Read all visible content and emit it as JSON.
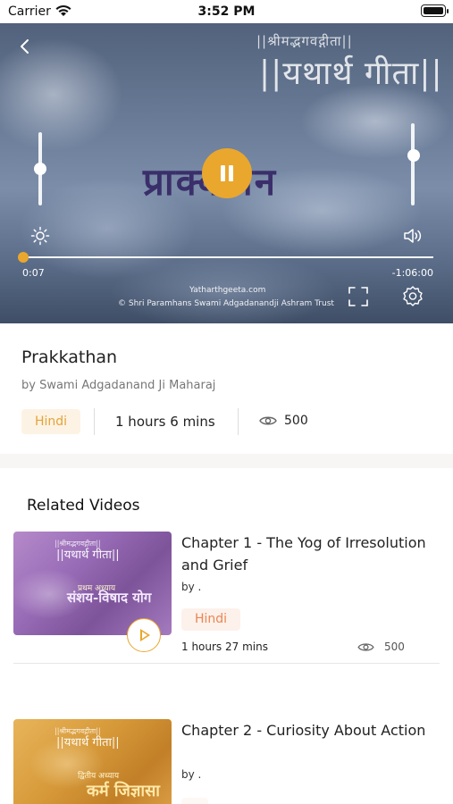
{
  "status_bar": {
    "carrier": "Carrier",
    "time": "3:52 PM",
    "icons": [
      "wifi-icon",
      "battery-icon"
    ]
  },
  "player": {
    "back_icon": "chevron-left-icon",
    "sub_title": "||श्रीमद्भगवद्गीता||",
    "title": "||यथार्थ गीता||",
    "center_text": "प्राक्कथन",
    "state": "playing",
    "pause_icon": "pause-icon",
    "brightness_level": 0.6,
    "volume_level": 0.62,
    "progress": 0.0,
    "current_time": "0:07",
    "remaining_time": "-1:06:00",
    "watermark_site": "Yatharthgeeta.com",
    "watermark_trust": "© Shri Paramhans Swami Adgadanandji Ashram Trust",
    "icons": [
      "brightness-icon",
      "volume-icon",
      "fullscreen-icon",
      "settings-icon"
    ],
    "accent_color": "#e9a72e"
  },
  "video": {
    "title": "Prakkathan",
    "author": "by Swami Adgadanand Ji Maharaj",
    "language": "Hindi",
    "duration": "1 hours 6 mins",
    "views_icon": "eye-icon",
    "views": "500"
  },
  "related": {
    "heading": "Related Videos",
    "items": [
      {
        "title": "Chapter 1 - The Yog of Irresolution and Grief",
        "by": "by .",
        "language": "Hindi",
        "duration": "1 hours 27 mins",
        "views": "500",
        "thumb_sub": "||श्रीमद्भगवद्गीता||",
        "thumb_title": "||यथार्थ गीता||",
        "thumb_caption": "प्रथम अध्याय",
        "thumb_text": "संशय-विषाद योग",
        "play_icon": "play-icon"
      },
      {
        "title": "Chapter 2 - Curiosity About Action",
        "by": "by .",
        "thumb_sub": "||श्रीमद्भगवद्गीता||",
        "thumb_title": "||यथार्थ गीता||",
        "thumb_caption": "द्वितीय अध्याय",
        "thumb_text": "कर्म जिज्ञासा"
      }
    ]
  },
  "colors": {
    "accent": "#e9a72e",
    "language_pill_bg": "#fdf3e4",
    "language_text": "#e3a43a",
    "card_language_text": "#ec8552"
  }
}
